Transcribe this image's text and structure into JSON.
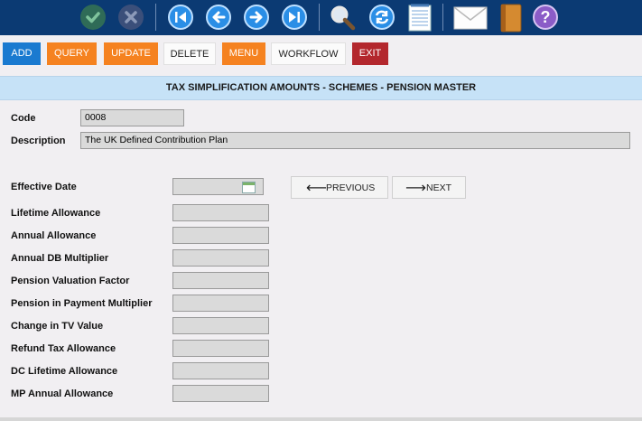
{
  "toolbar": {
    "icons": [
      "accept-icon",
      "cancel-icon",
      "first-icon",
      "previous-icon",
      "next-icon",
      "last-icon",
      "search-icon",
      "refresh-icon",
      "notes-icon",
      "mail-icon",
      "book-icon",
      "help-icon"
    ],
    "help_glyph": "?"
  },
  "actions": {
    "add": "ADD",
    "query": "QUERY",
    "update": "UPDATE",
    "delete": "DELETE",
    "menu": "MENU",
    "workflow": "WORKFLOW",
    "exit": "EXIT"
  },
  "title": "TAX SIMPLIFICATION AMOUNTS - SCHEMES - PENSION MASTER",
  "form": {
    "code_label": "Code",
    "code_value": "0008",
    "description_label": "Description",
    "description_value": "The UK Defined Contribution Plan",
    "effective_date_label": "Effective Date",
    "effective_date_value": "",
    "previous_label": "PREVIOUS",
    "next_label": "NEXT",
    "fields": [
      {
        "label": "Lifetime Allowance",
        "value": ""
      },
      {
        "label": "Annual Allowance",
        "value": ""
      },
      {
        "label": "Annual DB Multiplier",
        "value": ""
      },
      {
        "label": "Pension Valuation Factor",
        "value": ""
      },
      {
        "label": "Pension in Payment Multiplier",
        "value": ""
      },
      {
        "label": "Change in TV Value",
        "value": ""
      },
      {
        "label": "Refund Tax Allowance",
        "value": ""
      },
      {
        "label": "DC Lifetime Allowance",
        "value": ""
      },
      {
        "label": "MP Annual Allowance",
        "value": ""
      }
    ]
  },
  "colors": {
    "toolbar_bg": "#0b3a73",
    "add_blue": "#1a7ad0",
    "orange": "#f58220",
    "exit_red": "#b3272d",
    "title_bg": "#c6e2f7"
  }
}
